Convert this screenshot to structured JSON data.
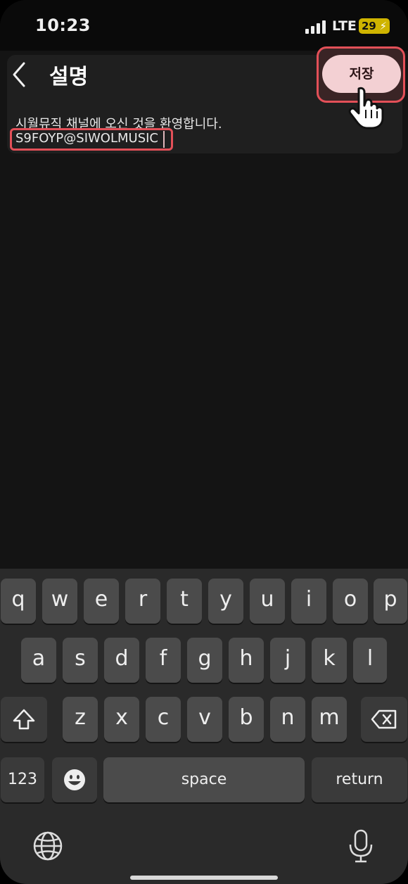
{
  "status_bar": {
    "time": "10:23",
    "network": "LTE",
    "battery": "29"
  },
  "header": {
    "back_icon": "chevron-left-icon",
    "title": "설명",
    "save_label": "저장"
  },
  "description": {
    "line1": "시월뮤직 채널에 오신 것을 환영합니다.",
    "line2": "S9FOYP@SIWOLMUSIC"
  },
  "keyboard": {
    "row1": [
      "q",
      "w",
      "e",
      "r",
      "t",
      "y",
      "u",
      "i",
      "o",
      "p"
    ],
    "row2": [
      "a",
      "s",
      "d",
      "f",
      "g",
      "h",
      "j",
      "k",
      "l"
    ],
    "row3": [
      "z",
      "x",
      "c",
      "v",
      "b",
      "n",
      "m"
    ],
    "numbers_label": "123",
    "space_label": "space",
    "return_label": "return",
    "icons": [
      "shift-icon",
      "backspace-icon",
      "emoji-icon",
      "globe-icon",
      "microphone-icon"
    ]
  },
  "colors": {
    "highlight": "#e35058",
    "save_button_bg": "#f3d0d3",
    "battery": "#cfb400"
  }
}
